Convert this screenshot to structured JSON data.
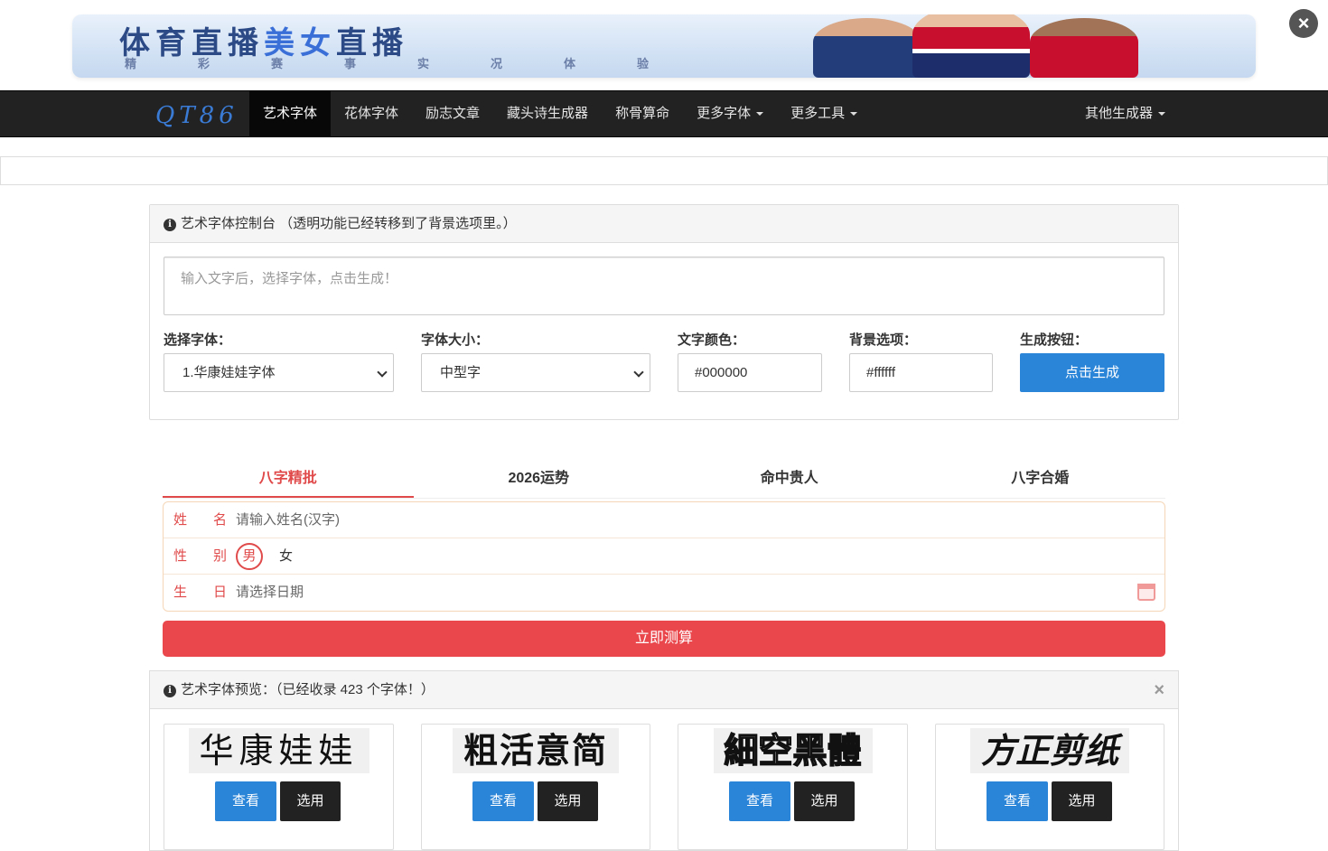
{
  "banner": {
    "title_part1": "体育直播",
    "title_part2": "美女",
    "title_part3": "直播",
    "subtitle": "精彩赛事实况体验",
    "close": "×"
  },
  "navbar": {
    "brand": "QT86",
    "items": [
      {
        "label": "艺术字体",
        "active": true
      },
      {
        "label": "花体字体"
      },
      {
        "label": "励志文章"
      },
      {
        "label": "藏头诗生成器"
      },
      {
        "label": "称骨算命"
      },
      {
        "label": "更多字体",
        "dropdown": true
      },
      {
        "label": "更多工具",
        "dropdown": true
      }
    ],
    "right_item": "其他生成器"
  },
  "console": {
    "title": "艺术字体控制台 （透明功能已经转移到了背景选项里。）",
    "textarea_placeholder": "输入文字后，选择字体，点击生成！",
    "font_label": "选择字体：",
    "font_value": "1.华康娃娃字体",
    "size_label": "字体大小：",
    "size_value": "中型字",
    "color_label": "文字颜色：",
    "color_value": "#000000",
    "bg_label": "背景选项：",
    "bg_value": "#ffffff",
    "generate_label": "生成按钮：",
    "generate_button": "点击生成"
  },
  "bazi": {
    "tabs": [
      "八字精批",
      "2026运势",
      "命中贵人",
      "八字合婚"
    ],
    "name_label": "姓名",
    "name_placeholder": "请输入姓名(汉字)",
    "gender_label": "性别",
    "gender_male": "男",
    "gender_female": "女",
    "birthday_label": "生日",
    "birthday_placeholder": "请选择日期",
    "submit": "立即测算"
  },
  "preview": {
    "title": "艺术字体预览：（已经收录 423 个字体！）",
    "close": "×",
    "fonts": [
      {
        "sample": "华康娃娃"
      },
      {
        "sample": "粗活意简"
      },
      {
        "sample": "細空黑體"
      },
      {
        "sample": "方正剪纸"
      }
    ],
    "view_label": "查看",
    "select_label": "选用"
  },
  "colors": {
    "accent_blue": "#2a84d8",
    "accent_red": "#e9474c",
    "navbar_bg": "#222222"
  }
}
